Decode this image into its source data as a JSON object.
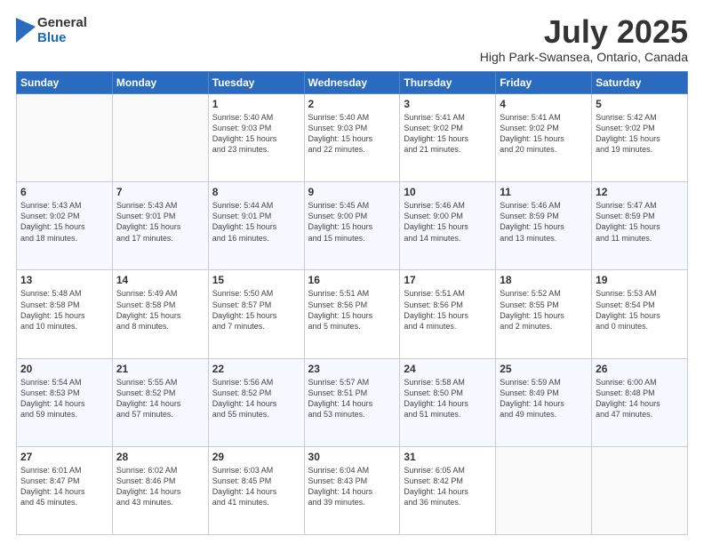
{
  "logo": {
    "general": "General",
    "blue": "Blue"
  },
  "header": {
    "month": "July 2025",
    "location": "High Park-Swansea, Ontario, Canada"
  },
  "weekdays": [
    "Sunday",
    "Monday",
    "Tuesday",
    "Wednesday",
    "Thursday",
    "Friday",
    "Saturday"
  ],
  "weeks": [
    [
      {
        "day": "",
        "info": ""
      },
      {
        "day": "",
        "info": ""
      },
      {
        "day": "1",
        "info": "Sunrise: 5:40 AM\nSunset: 9:03 PM\nDaylight: 15 hours\nand 23 minutes."
      },
      {
        "day": "2",
        "info": "Sunrise: 5:40 AM\nSunset: 9:03 PM\nDaylight: 15 hours\nand 22 minutes."
      },
      {
        "day": "3",
        "info": "Sunrise: 5:41 AM\nSunset: 9:02 PM\nDaylight: 15 hours\nand 21 minutes."
      },
      {
        "day": "4",
        "info": "Sunrise: 5:41 AM\nSunset: 9:02 PM\nDaylight: 15 hours\nand 20 minutes."
      },
      {
        "day": "5",
        "info": "Sunrise: 5:42 AM\nSunset: 9:02 PM\nDaylight: 15 hours\nand 19 minutes."
      }
    ],
    [
      {
        "day": "6",
        "info": "Sunrise: 5:43 AM\nSunset: 9:02 PM\nDaylight: 15 hours\nand 18 minutes."
      },
      {
        "day": "7",
        "info": "Sunrise: 5:43 AM\nSunset: 9:01 PM\nDaylight: 15 hours\nand 17 minutes."
      },
      {
        "day": "8",
        "info": "Sunrise: 5:44 AM\nSunset: 9:01 PM\nDaylight: 15 hours\nand 16 minutes."
      },
      {
        "day": "9",
        "info": "Sunrise: 5:45 AM\nSunset: 9:00 PM\nDaylight: 15 hours\nand 15 minutes."
      },
      {
        "day": "10",
        "info": "Sunrise: 5:46 AM\nSunset: 9:00 PM\nDaylight: 15 hours\nand 14 minutes."
      },
      {
        "day": "11",
        "info": "Sunrise: 5:46 AM\nSunset: 8:59 PM\nDaylight: 15 hours\nand 13 minutes."
      },
      {
        "day": "12",
        "info": "Sunrise: 5:47 AM\nSunset: 8:59 PM\nDaylight: 15 hours\nand 11 minutes."
      }
    ],
    [
      {
        "day": "13",
        "info": "Sunrise: 5:48 AM\nSunset: 8:58 PM\nDaylight: 15 hours\nand 10 minutes."
      },
      {
        "day": "14",
        "info": "Sunrise: 5:49 AM\nSunset: 8:58 PM\nDaylight: 15 hours\nand 8 minutes."
      },
      {
        "day": "15",
        "info": "Sunrise: 5:50 AM\nSunset: 8:57 PM\nDaylight: 15 hours\nand 7 minutes."
      },
      {
        "day": "16",
        "info": "Sunrise: 5:51 AM\nSunset: 8:56 PM\nDaylight: 15 hours\nand 5 minutes."
      },
      {
        "day": "17",
        "info": "Sunrise: 5:51 AM\nSunset: 8:56 PM\nDaylight: 15 hours\nand 4 minutes."
      },
      {
        "day": "18",
        "info": "Sunrise: 5:52 AM\nSunset: 8:55 PM\nDaylight: 15 hours\nand 2 minutes."
      },
      {
        "day": "19",
        "info": "Sunrise: 5:53 AM\nSunset: 8:54 PM\nDaylight: 15 hours\nand 0 minutes."
      }
    ],
    [
      {
        "day": "20",
        "info": "Sunrise: 5:54 AM\nSunset: 8:53 PM\nDaylight: 14 hours\nand 59 minutes."
      },
      {
        "day": "21",
        "info": "Sunrise: 5:55 AM\nSunset: 8:52 PM\nDaylight: 14 hours\nand 57 minutes."
      },
      {
        "day": "22",
        "info": "Sunrise: 5:56 AM\nSunset: 8:52 PM\nDaylight: 14 hours\nand 55 minutes."
      },
      {
        "day": "23",
        "info": "Sunrise: 5:57 AM\nSunset: 8:51 PM\nDaylight: 14 hours\nand 53 minutes."
      },
      {
        "day": "24",
        "info": "Sunrise: 5:58 AM\nSunset: 8:50 PM\nDaylight: 14 hours\nand 51 minutes."
      },
      {
        "day": "25",
        "info": "Sunrise: 5:59 AM\nSunset: 8:49 PM\nDaylight: 14 hours\nand 49 minutes."
      },
      {
        "day": "26",
        "info": "Sunrise: 6:00 AM\nSunset: 8:48 PM\nDaylight: 14 hours\nand 47 minutes."
      }
    ],
    [
      {
        "day": "27",
        "info": "Sunrise: 6:01 AM\nSunset: 8:47 PM\nDaylight: 14 hours\nand 45 minutes."
      },
      {
        "day": "28",
        "info": "Sunrise: 6:02 AM\nSunset: 8:46 PM\nDaylight: 14 hours\nand 43 minutes."
      },
      {
        "day": "29",
        "info": "Sunrise: 6:03 AM\nSunset: 8:45 PM\nDaylight: 14 hours\nand 41 minutes."
      },
      {
        "day": "30",
        "info": "Sunrise: 6:04 AM\nSunset: 8:43 PM\nDaylight: 14 hours\nand 39 minutes."
      },
      {
        "day": "31",
        "info": "Sunrise: 6:05 AM\nSunset: 8:42 PM\nDaylight: 14 hours\nand 36 minutes."
      },
      {
        "day": "",
        "info": ""
      },
      {
        "day": "",
        "info": ""
      }
    ]
  ]
}
